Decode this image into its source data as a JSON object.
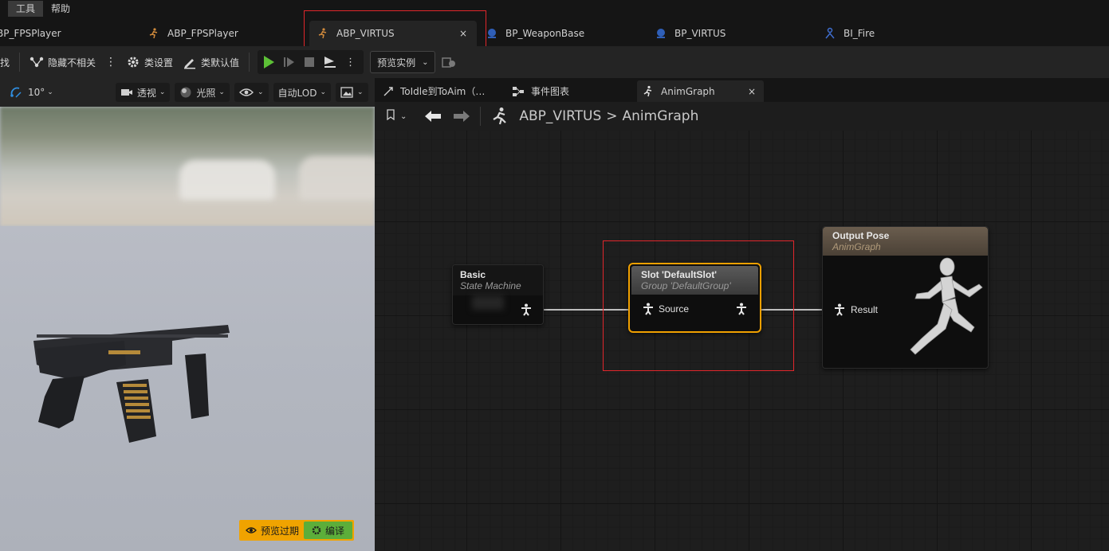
{
  "menubar": {
    "items": [
      "工具",
      "帮助"
    ]
  },
  "asset_tabs": [
    {
      "label": "BP_FPSPlayer",
      "icon": "blueprint-icon"
    },
    {
      "label": "ABP_FPSPlayer",
      "icon": "anim-blueprint-icon"
    },
    {
      "label": "ABP_VIRTUS",
      "icon": "anim-blueprint-icon",
      "close": "×"
    },
    {
      "label": "BP_WeaponBase",
      "icon": "blueprint-icon"
    },
    {
      "label": "BP_VIRTUS",
      "icon": "blueprint-icon"
    },
    {
      "label": "BI_Fire",
      "icon": "interface-icon"
    }
  ],
  "toolbar": {
    "find_label": "找",
    "hide_unrelated_label": "隐藏不相关",
    "class_settings_label": "类设置",
    "class_defaults_label": "类默认值",
    "debug_instance_label": "预览实例"
  },
  "viewport": {
    "fov_label": "10°",
    "perspective_label": "透视",
    "lighting_label": "光照",
    "lod_label": "自动LOD",
    "preview_outdated_label": "预览过期",
    "compile_label": "编译"
  },
  "graph_tabs": [
    {
      "label": "ToIdle到ToAim（…",
      "icon": "transition-icon"
    },
    {
      "label": "事件图表",
      "icon": "event-graph-icon"
    },
    {
      "label": "AnimGraph",
      "icon": "anim-graph-icon",
      "close": "×"
    }
  ],
  "breadcrumb": {
    "root": "ABP_VIRTUS",
    "sep": ">",
    "leaf": "AnimGraph"
  },
  "nodes": {
    "basic": {
      "title": "Basic",
      "subtitle": "State Machine"
    },
    "slot": {
      "title": "Slot 'DefaultSlot'",
      "subtitle": "Group 'DefaultGroup'",
      "pin": "Source"
    },
    "output": {
      "title": "Output Pose",
      "subtitle": "AnimGraph",
      "pin": "Result"
    }
  },
  "colors": {
    "highlight_red": "#e0262b",
    "slot_border": "#f0a000",
    "play_green": "#5cc036",
    "compile_green": "#5cae3a",
    "warning_orange": "#f0a300"
  }
}
